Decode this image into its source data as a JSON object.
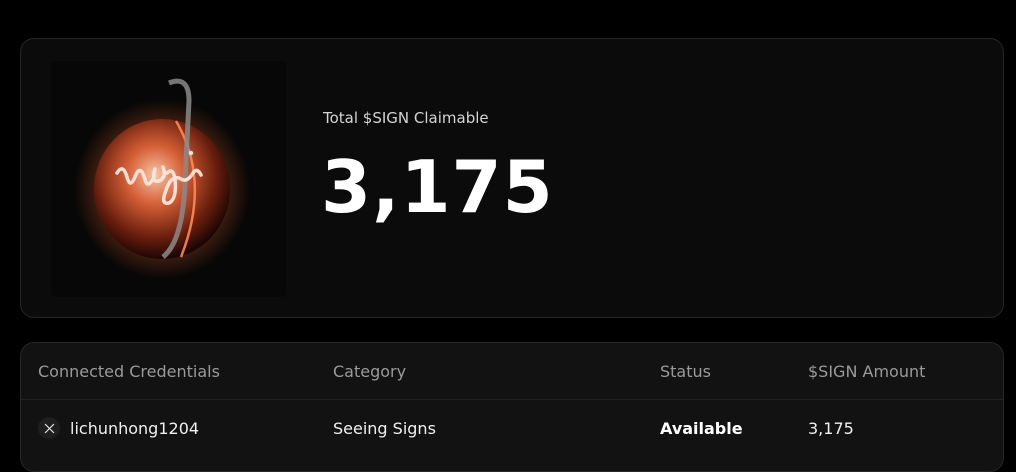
{
  "claim": {
    "label": "Total $SIGN Claimable",
    "amount": "3,175",
    "art_icon": "glowing-orb-sign-logo"
  },
  "table": {
    "headers": [
      "Connected Credentials",
      "Category",
      "Status",
      "$SIGN Amount"
    ],
    "rows": [
      {
        "icon": "x-logo-icon",
        "credential": "lichunhong1204",
        "category": "Seeing Signs",
        "status": "Available",
        "amount": "3,175"
      }
    ]
  },
  "colors": {
    "background": "#000000",
    "card": "#0b0b0b",
    "table": "#121212",
    "orb_glow": "#ff7a3d"
  }
}
